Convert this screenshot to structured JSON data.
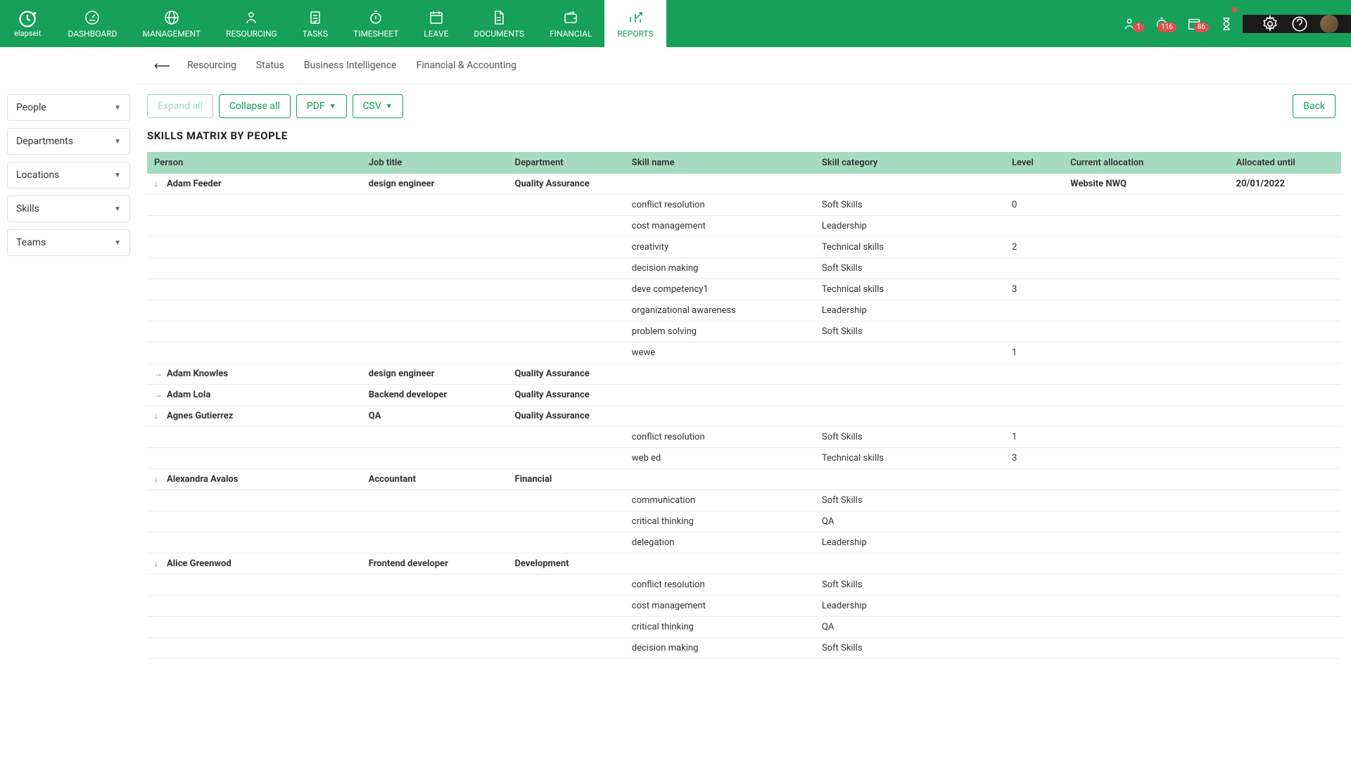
{
  "brand": "elapseit",
  "nav": [
    {
      "label": "DASHBOARD"
    },
    {
      "label": "MANAGEMENT"
    },
    {
      "label": "RESOURCING"
    },
    {
      "label": "TASKS"
    },
    {
      "label": "TIMESHEET"
    },
    {
      "label": "LEAVE"
    },
    {
      "label": "DOCUMENTS"
    },
    {
      "label": "FINANCIAL"
    },
    {
      "label": "REPORTS"
    }
  ],
  "badges": {
    "people": "1",
    "clock": "116",
    "calendar": "86"
  },
  "subtabs": [
    "Resourcing",
    "Status",
    "Business Intelligence",
    "Financial & Accounting"
  ],
  "filters": [
    "People",
    "Departments",
    "Locations",
    "Skills",
    "Teams"
  ],
  "toolbar": {
    "expand": "Expand all",
    "collapse": "Collapse all",
    "pdf": "PDF",
    "csv": "CSV",
    "back": "Back"
  },
  "page_title": "SKILLS MATRIX BY PEOPLE",
  "columns": [
    "Person",
    "Job title",
    "Department",
    "Skill name",
    "Skill category",
    "Level",
    "Current allocation",
    "Allocated until"
  ],
  "rows": [
    {
      "type": "person",
      "expand": "down",
      "person": "Adam Feeder",
      "job": "design engineer",
      "dept": "Quality Assurance",
      "alloc": "Website NWQ",
      "until": "20/01/2022"
    },
    {
      "type": "skill",
      "skill": "conflict resolution",
      "cat": "Soft Skills",
      "level": "0"
    },
    {
      "type": "skill",
      "skill": "cost management",
      "cat": "Leadership",
      "level": ""
    },
    {
      "type": "skill",
      "skill": "creativity",
      "cat": "Technical skills",
      "level": "2"
    },
    {
      "type": "skill",
      "skill": "decision making",
      "cat": "Soft Skills",
      "level": ""
    },
    {
      "type": "skill",
      "skill": "deve competency1",
      "cat": "Technical skills",
      "level": "3"
    },
    {
      "type": "skill",
      "skill": "organizational awareness",
      "cat": "Leadership",
      "level": ""
    },
    {
      "type": "skill",
      "skill": "problem solving",
      "cat": "Soft Skills",
      "level": ""
    },
    {
      "type": "skill",
      "skill": "wewe",
      "cat": "",
      "level": "1"
    },
    {
      "type": "person",
      "expand": "right",
      "person": "Adam Knowles",
      "job": "design engineer",
      "dept": "Quality Assurance"
    },
    {
      "type": "person",
      "expand": "right",
      "person": "Adam Lola",
      "job": "Backend developer",
      "dept": "Quality Assurance"
    },
    {
      "type": "person",
      "expand": "down",
      "person": "Agnes Gutierrez",
      "job": "QA",
      "dept": "Quality Assurance"
    },
    {
      "type": "skill",
      "skill": "conflict resolution",
      "cat": "Soft Skills",
      "level": "1"
    },
    {
      "type": "skill",
      "skill": "web ed",
      "cat": "Technical skills",
      "level": "3"
    },
    {
      "type": "person",
      "expand": "down",
      "person": "Alexandra Avalos",
      "job": "Accountant",
      "dept": "Financial"
    },
    {
      "type": "skill",
      "skill": "communication",
      "cat": "Soft Skills",
      "level": ""
    },
    {
      "type": "skill",
      "skill": "critical thinking",
      "cat": "QA",
      "level": ""
    },
    {
      "type": "skill",
      "skill": "delegation",
      "cat": "Leadership",
      "level": ""
    },
    {
      "type": "person",
      "expand": "down",
      "person": "Alice Greenwod",
      "job": "Frontend developer",
      "dept": "Development"
    },
    {
      "type": "skill",
      "skill": "conflict resolution",
      "cat": "Soft Skills",
      "level": ""
    },
    {
      "type": "skill",
      "skill": "cost management",
      "cat": "Leadership",
      "level": ""
    },
    {
      "type": "skill",
      "skill": "critical thinking",
      "cat": "QA",
      "level": ""
    },
    {
      "type": "skill",
      "skill": "decision making",
      "cat": "Soft Skills",
      "level": ""
    }
  ]
}
